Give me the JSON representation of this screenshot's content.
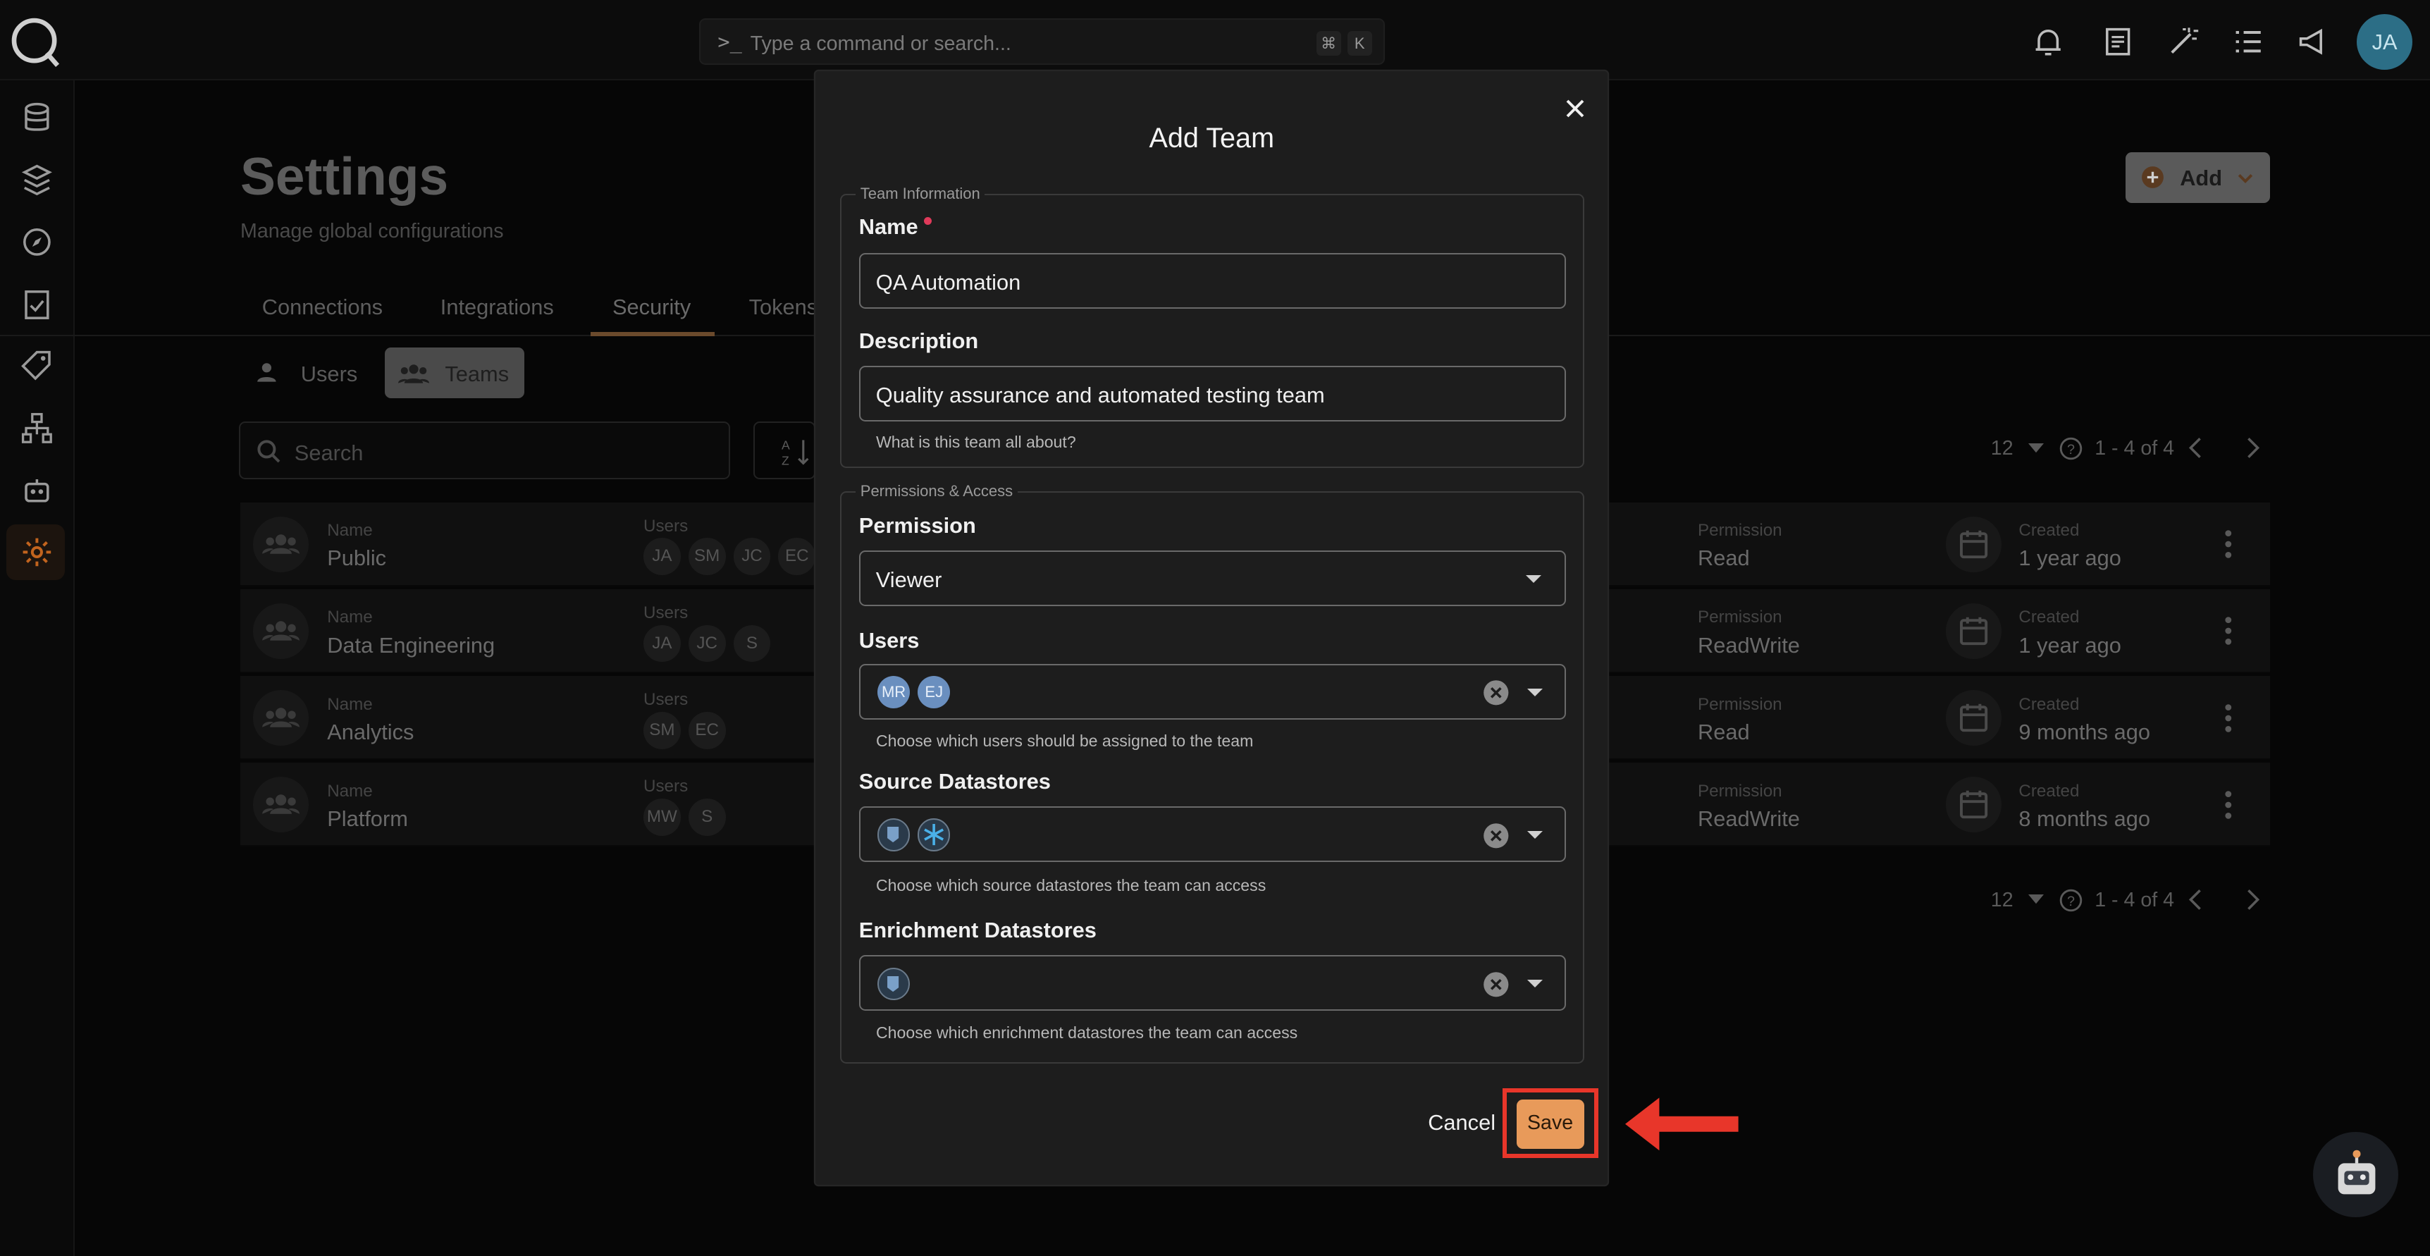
{
  "topbar": {
    "command_placeholder": "Type a command or search...",
    "kbd_cmd": "⌘",
    "kbd_k": "K",
    "user_initials": "JA"
  },
  "page": {
    "title": "Settings",
    "subtitle": "Manage global configurations",
    "add_label": "Add",
    "tabs": [
      "Connections",
      "Integrations",
      "Security",
      "Tokens"
    ],
    "active_tab": "Security",
    "segments": [
      "Users",
      "Teams"
    ],
    "active_segment": "Teams",
    "search_placeholder": "Search",
    "per_page": "12",
    "page_range": "1 - 4 of 4"
  },
  "table": {
    "name_label": "Name",
    "users_label": "Users",
    "permission_label": "Permission",
    "created_label": "Created",
    "rows": [
      {
        "name": "Public",
        "users": [
          "JA",
          "SM",
          "JC",
          "EC"
        ],
        "permission": "Read",
        "created": "1 year ago"
      },
      {
        "name": "Data Engineering",
        "users": [
          "JA",
          "JC",
          "S"
        ],
        "permission": "ReadWrite",
        "created": "1 year ago"
      },
      {
        "name": "Analytics",
        "users": [
          "SM",
          "EC"
        ],
        "permission": "Read",
        "created": "9 months ago"
      },
      {
        "name": "Platform",
        "users": [
          "MW",
          "S"
        ],
        "permission": "ReadWrite",
        "created": "8 months ago"
      }
    ]
  },
  "modal": {
    "title": "Add Team",
    "team_info_legend": "Team Information",
    "name_label": "Name",
    "name_value": "QA Automation",
    "description_label": "Description",
    "description_value": "Quality assurance and automated testing team",
    "description_help": "What is this team all about?",
    "permissions_legend": "Permissions & Access",
    "permission_label": "Permission",
    "permission_value": "Viewer",
    "users_label": "Users",
    "selected_users": [
      "MR",
      "EJ"
    ],
    "users_help": "Choose which users should be assigned to the team",
    "source_label": "Source Datastores",
    "source_help": "Choose which source datastores the team can access",
    "enrichment_label": "Enrichment Datastores",
    "enrichment_help": "Choose which enrichment datastores the team can access",
    "cancel_label": "Cancel",
    "save_label": "Save"
  },
  "colors": {
    "accent": "#e89a5a",
    "highlight": "#e8362a",
    "required": "#e03a5a"
  }
}
